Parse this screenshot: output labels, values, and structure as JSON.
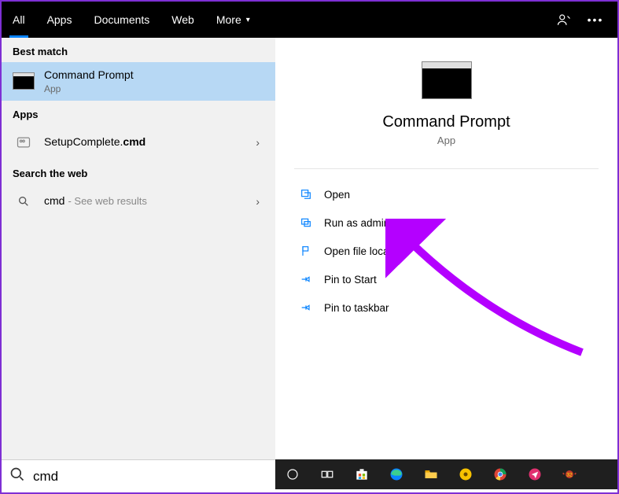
{
  "tabs": {
    "all": "All",
    "apps": "Apps",
    "documents": "Documents",
    "web": "Web",
    "more": "More"
  },
  "sections": {
    "best_match": "Best match",
    "apps": "Apps",
    "search_web": "Search the web"
  },
  "results": {
    "best": {
      "title": "Command Prompt",
      "subtitle": "App"
    },
    "app1": {
      "prefix": "SetupComplete.",
      "bold": "cmd"
    },
    "web": {
      "query": "cmd",
      "hint": " - See web results"
    }
  },
  "preview": {
    "title": "Command Prompt",
    "subtitle": "App"
  },
  "actions": {
    "open": "Open",
    "run_admin": "Run as administrator",
    "open_loc": "Open file location",
    "pin_start": "Pin to Start",
    "pin_taskbar": "Pin to taskbar"
  },
  "search": {
    "value": "cmd"
  },
  "taskbar_icons": [
    "cortana",
    "task-view",
    "store",
    "edge",
    "explorer",
    "bandicam",
    "chrome",
    "send",
    "fraps"
  ]
}
